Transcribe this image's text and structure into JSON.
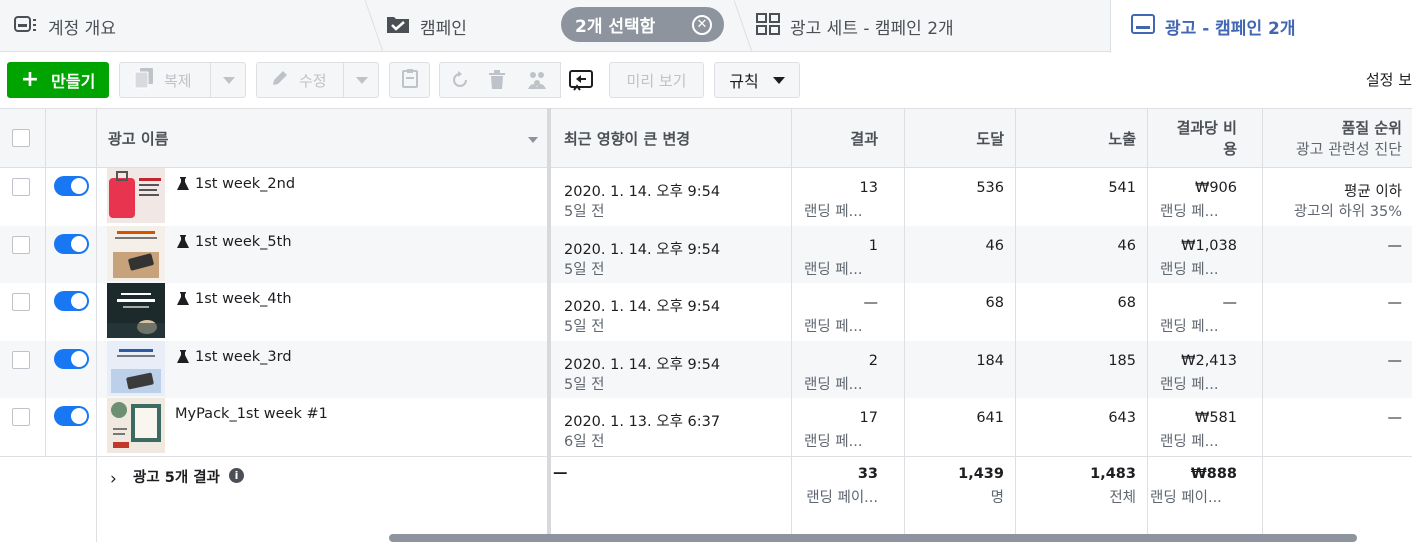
{
  "tabs": {
    "account": "계정 개요",
    "campaigns": "캠페인",
    "selected_pill": "2개 선택함",
    "adsets": "광고 세트 - 캠페인 2개",
    "ads": "광고 - 캠페인 2개"
  },
  "toolbar": {
    "create": "만들기",
    "duplicate": "복제",
    "edit": "수정",
    "preview": "미리 보기",
    "rules": "규칙",
    "settings": "설정 보"
  },
  "columns": {
    "ad_name": "광고 이름",
    "recent_changes": "최근 영향이 큰 변경",
    "results": "결과",
    "reach": "도달",
    "impressions": "노출",
    "cost_per_result_1": "결과당 비",
    "cost_per_result_2": "용",
    "quality_rank": "품질 순위",
    "quality_rank_sub": "광고 관련성 진단"
  },
  "rows": [
    {
      "name": "1st week_2nd",
      "experiment": true,
      "changed": "2020. 1. 14. 오후 9:54",
      "changed_ago": "5일 전",
      "results": "13",
      "results_sub": "랜딩 페...",
      "reach": "536",
      "impressions": "541",
      "cost": "₩906",
      "cost_sub": "랜딩 페...",
      "quality": "평균 이하",
      "quality_sub": "광고의 하위 35%"
    },
    {
      "name": "1st week_5th",
      "experiment": true,
      "changed": "2020. 1. 14. 오후 9:54",
      "changed_ago": "5일 전",
      "results": "1",
      "results_sub": "랜딩 페...",
      "reach": "46",
      "impressions": "46",
      "cost": "₩1,038",
      "cost_sub": "랜딩 페...",
      "quality": "—",
      "quality_sub": ""
    },
    {
      "name": "1st week_4th",
      "experiment": true,
      "changed": "2020. 1. 14. 오후 9:54",
      "changed_ago": "5일 전",
      "results": "—",
      "results_sub": "랜딩 페...",
      "reach": "68",
      "impressions": "68",
      "cost": "—",
      "cost_sub": "랜딩 페...",
      "quality": "—",
      "quality_sub": ""
    },
    {
      "name": "1st week_3rd",
      "experiment": true,
      "changed": "2020. 1. 14. 오후 9:54",
      "changed_ago": "5일 전",
      "results": "2",
      "results_sub": "랜딩 페...",
      "reach": "184",
      "impressions": "185",
      "cost": "₩2,413",
      "cost_sub": "랜딩 페...",
      "quality": "—",
      "quality_sub": ""
    },
    {
      "name": "MyPack_1st week #1",
      "experiment": false,
      "changed": "2020. 1. 13. 오후 6:37",
      "changed_ago": "6일 전",
      "results": "17",
      "results_sub": "랜딩 페...",
      "reach": "641",
      "impressions": "643",
      "cost": "₩581",
      "cost_sub": "랜딩 페...",
      "quality": "—",
      "quality_sub": ""
    }
  ],
  "totals": {
    "label": "광고 5개 결과",
    "changed": "—",
    "results": "33",
    "results_sub": "랜딩 페이...",
    "reach": "1,439",
    "reach_sub": "명",
    "impressions": "1,483",
    "impressions_sub": "전체",
    "cost": "₩888",
    "cost_sub": "랜딩 페이..."
  },
  "colors": {
    "accent": "#4267b2",
    "create": "#00a400",
    "toggle": "#1877f2"
  }
}
